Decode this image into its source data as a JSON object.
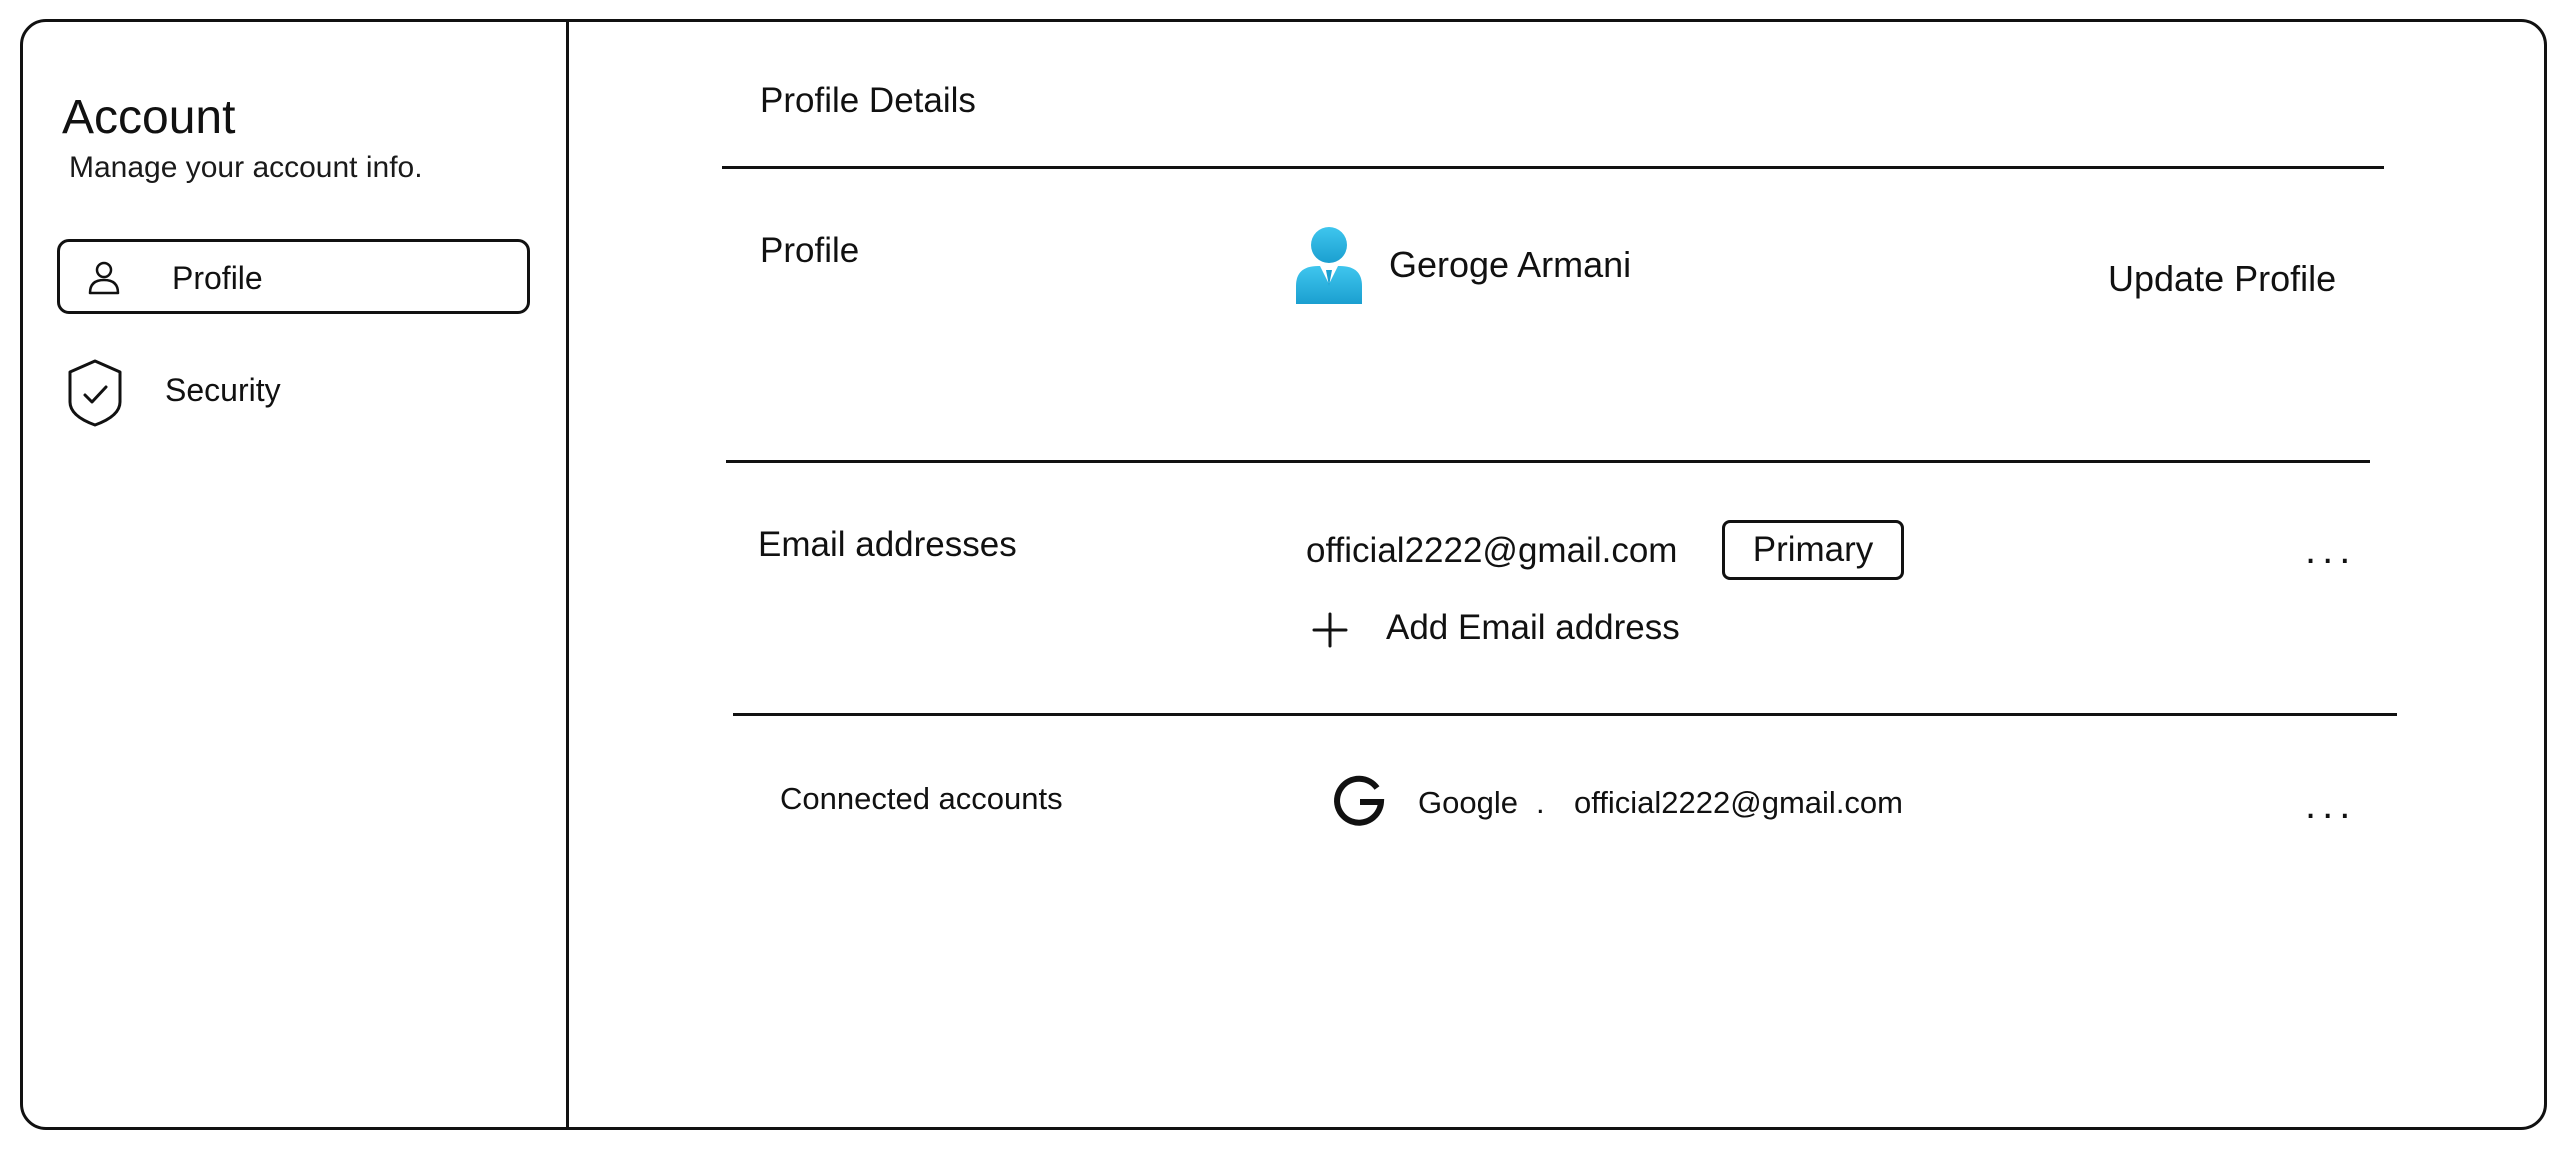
{
  "sidebar": {
    "title": "Account",
    "subtitle": "Manage your account info.",
    "items": [
      {
        "label": "Profile",
        "icon": "user-icon",
        "active": true
      },
      {
        "label": "Security",
        "icon": "shield-check-icon",
        "active": false
      }
    ]
  },
  "main": {
    "title": "Profile Details",
    "profile": {
      "label": "Profile",
      "avatar_icon": "avatar-icon",
      "avatar_color": "#29b6e0",
      "name": "Geroge Armani",
      "update_label": "Update Profile"
    },
    "email": {
      "label": "Email addresses",
      "address": "official2222@gmail.com",
      "badge": "Primary",
      "more": "...",
      "add_label": "Add  Email address"
    },
    "connected": {
      "label": "Connected  accounts",
      "provider_icon": "google-icon",
      "provider": "Google",
      "separator": ".",
      "email": "official2222@gmail.com",
      "more": "..."
    }
  }
}
